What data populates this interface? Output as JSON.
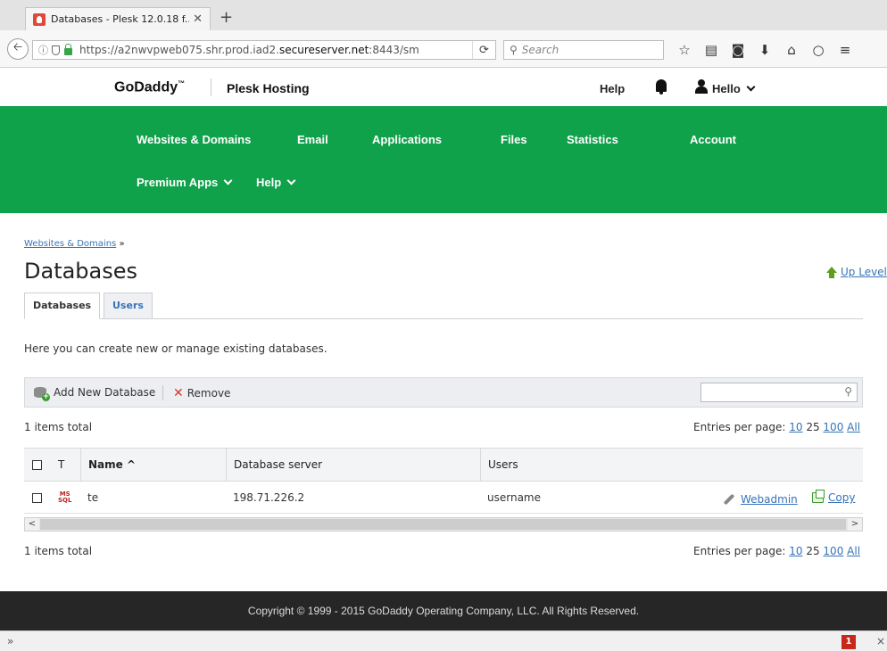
{
  "browser": {
    "tab_title": "Databases - Plesk 12.0.18 f...",
    "tab_close": "✕",
    "new_tab": "+",
    "url_prefix": "https://a2nwvpweb075.shr.prod.iad2.",
    "url_domain": "secureserver.net",
    "url_suffix": ":8443/sm",
    "reload": "⟳",
    "search_placeholder": "Search",
    "toolbar_icons": [
      "star-icon",
      "reading-list-icon",
      "pocket-icon",
      "download-icon",
      "home-icon",
      "chat-icon",
      "menu-icon"
    ]
  },
  "header": {
    "logo": "GoDaddy",
    "logo_tm": "™",
    "product": "Plesk Hosting",
    "help": "Help",
    "user": "Hello"
  },
  "nav": {
    "row1": [
      "Websites & Domains",
      "Email",
      "Applications",
      "Files",
      "Statistics",
      "Account"
    ],
    "row2": [
      "Premium Apps",
      "Help"
    ]
  },
  "breadcrumb": {
    "link": "Websites & Domains",
    "sep": "»"
  },
  "page": {
    "title": "Databases",
    "up_level": "Up Level",
    "tabs": [
      "Databases",
      "Users"
    ],
    "intro": "Here you can create new or manage existing databases."
  },
  "toolbar": {
    "add_label": "Add New Database",
    "remove_label": "Remove"
  },
  "list": {
    "total_text": "1 items total",
    "entries_label": "Entries per page:",
    "entries_options": [
      "10",
      "25",
      "100",
      "All"
    ],
    "columns": {
      "type": "T",
      "name": "Name ^",
      "server": "Database server",
      "users": "Users"
    },
    "rows": [
      {
        "type_top": "MS",
        "type_bottom": "SQL",
        "name": "te",
        "server": "198.71.226.2",
        "users": "username",
        "webadmin": "Webadmin",
        "copy": "Copy"
      }
    ]
  },
  "scroll": {
    "left": "<",
    "right": ">"
  },
  "footer": {
    "text": "Copyright © 1999 - 2015 GoDaddy Operating Company, LLC. All Rights Reserved."
  },
  "statusbar": {
    "chevrons": "»",
    "badge": "1",
    "close": "×"
  }
}
